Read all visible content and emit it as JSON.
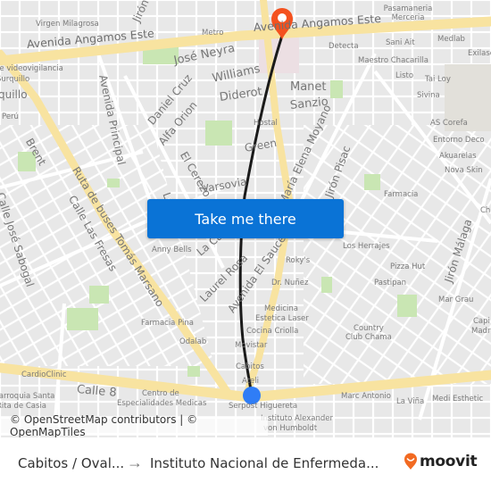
{
  "map": {
    "colors": {
      "background": "#efefef",
      "block": "#e6e6e6",
      "road": "#ffffff",
      "major_road": "#f8e3a0",
      "park": "#c9e6b3",
      "route_line": "#1a1a1a",
      "destination_pin": "#f4511e",
      "origin_dot": "#2f7df6"
    },
    "route": {
      "origin_label": "Serpost Higuereta",
      "destination_label": "Avenida Angamos Este"
    },
    "street_labels": [
      "Avenida Angamos Este",
      "Avenida Angamos Este",
      "José Neyra",
      "Williams",
      "Diderot",
      "Manet",
      "Sanzio",
      "Daniel Cruz",
      "Alfa Orion",
      "El Cerezo",
      "Varsovia",
      "Green",
      "Avenida Principal",
      "Brent",
      "Ruta de buses Tomás Marsano",
      "Calle Las Fresas",
      "Calle José Sabogal",
      "María Elena Moyano",
      "Jirón Pisac",
      "Jirón Málaga",
      "Laurel Rosa",
      "Avenida El Sauce",
      "La Ca",
      "La",
      "Calle 8",
      "Jirón"
    ],
    "poi_labels": [
      "Virgen Milagrosa",
      "Metro",
      "Pasamaneria Merceria",
      "Sani Ait",
      "Medlab",
      "Detecta",
      "Maestro Chacarilla",
      "Exilase",
      "Listo",
      "Tai Loy",
      "Sivina",
      "AS Corefa",
      "Entorno Deco",
      "Akuarelas",
      "Nova Skin",
      "Farmacia",
      "Hostal",
      "de videovigilancia",
      "Surquillo",
      "quillo",
      "Perú",
      "Anny Bells",
      "Los Herrajes",
      "Roky's",
      "Pizza Hut",
      "Pastipan",
      "Dr. Nuñez",
      "Mar Grau",
      "Medicina",
      "Estetica Laser",
      "Cocina Criolla",
      "Movistar",
      "Country",
      "Club Chama",
      "Cabitos",
      "Ateli",
      "Serpost Higuereta",
      "Farmacia Pina",
      "Odalab",
      "CardioClinic",
      "Parroquia Santa",
      "Rita de Casia",
      "Centro de",
      "Especialidades Medicas",
      "Marc Antonio",
      "La Viña",
      "Medi Esthetic",
      "Instituto Alexander",
      "von Humboldt",
      "Chi",
      "Capi",
      "Madr"
    ]
  },
  "cta": {
    "label": "Take me there"
  },
  "attribution": {
    "text": "© OpenStreetMap contributors | © OpenMapTiles"
  },
  "footer": {
    "origin": "Cabitos / Oval...",
    "arrow": "→",
    "destination": "Instituto Nacional de Enfermeda...",
    "brand": "moovit",
    "brand_color": "#f26a21"
  }
}
